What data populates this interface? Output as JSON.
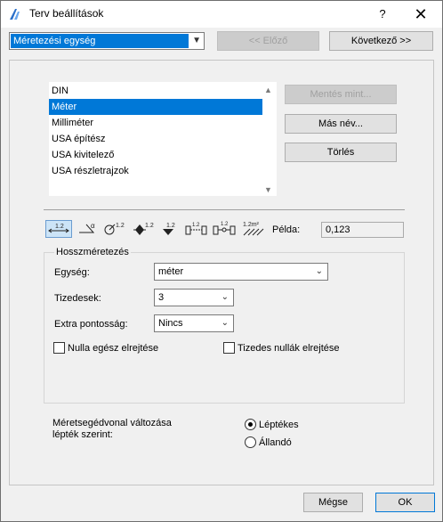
{
  "window": {
    "title": "Terv beállítások",
    "help": "?",
    "close": "✕"
  },
  "top": {
    "category_select": "Méretezési egység",
    "prev_button": "<< Előző",
    "next_button": "Következő >>"
  },
  "presets": {
    "items": [
      "DIN",
      "Méter",
      "Milliméter",
      "USA építész",
      "USA kivitelező",
      "USA részletrajzok"
    ],
    "selected_index": 1,
    "save_as_button": "Mentés mint...",
    "rename_button": "Más név...",
    "delete_button": "Törlés"
  },
  "toolbar": {
    "icons": [
      "1.2",
      "∠°",
      "⊙1.2",
      "⌖1.2",
      "▼1.2",
      "▮+▮",
      "▮+▮",
      "1.2m²"
    ],
    "example_label": "Példa:",
    "example_value": "0,123"
  },
  "length": {
    "group_title": "Hosszméretezés",
    "unit_label": "Egység:",
    "unit_value": "méter",
    "decimals_label": "Tizedesek:",
    "decimals_value": "3",
    "extra_label": "Extra pontosság:",
    "extra_value": "Nincs",
    "hide_zero_whole": "Nulla egész elrejtése",
    "hide_zero_decimals": "Tizedes nullák elrejtése"
  },
  "scale": {
    "label_line1": "Méretsegédvonal változása",
    "label_line2": "lépték szerint:",
    "option1": "Léptékes",
    "option2": "Állandó",
    "selected": "Léptékes"
  },
  "footer": {
    "cancel": "Mégse",
    "ok": "OK"
  }
}
